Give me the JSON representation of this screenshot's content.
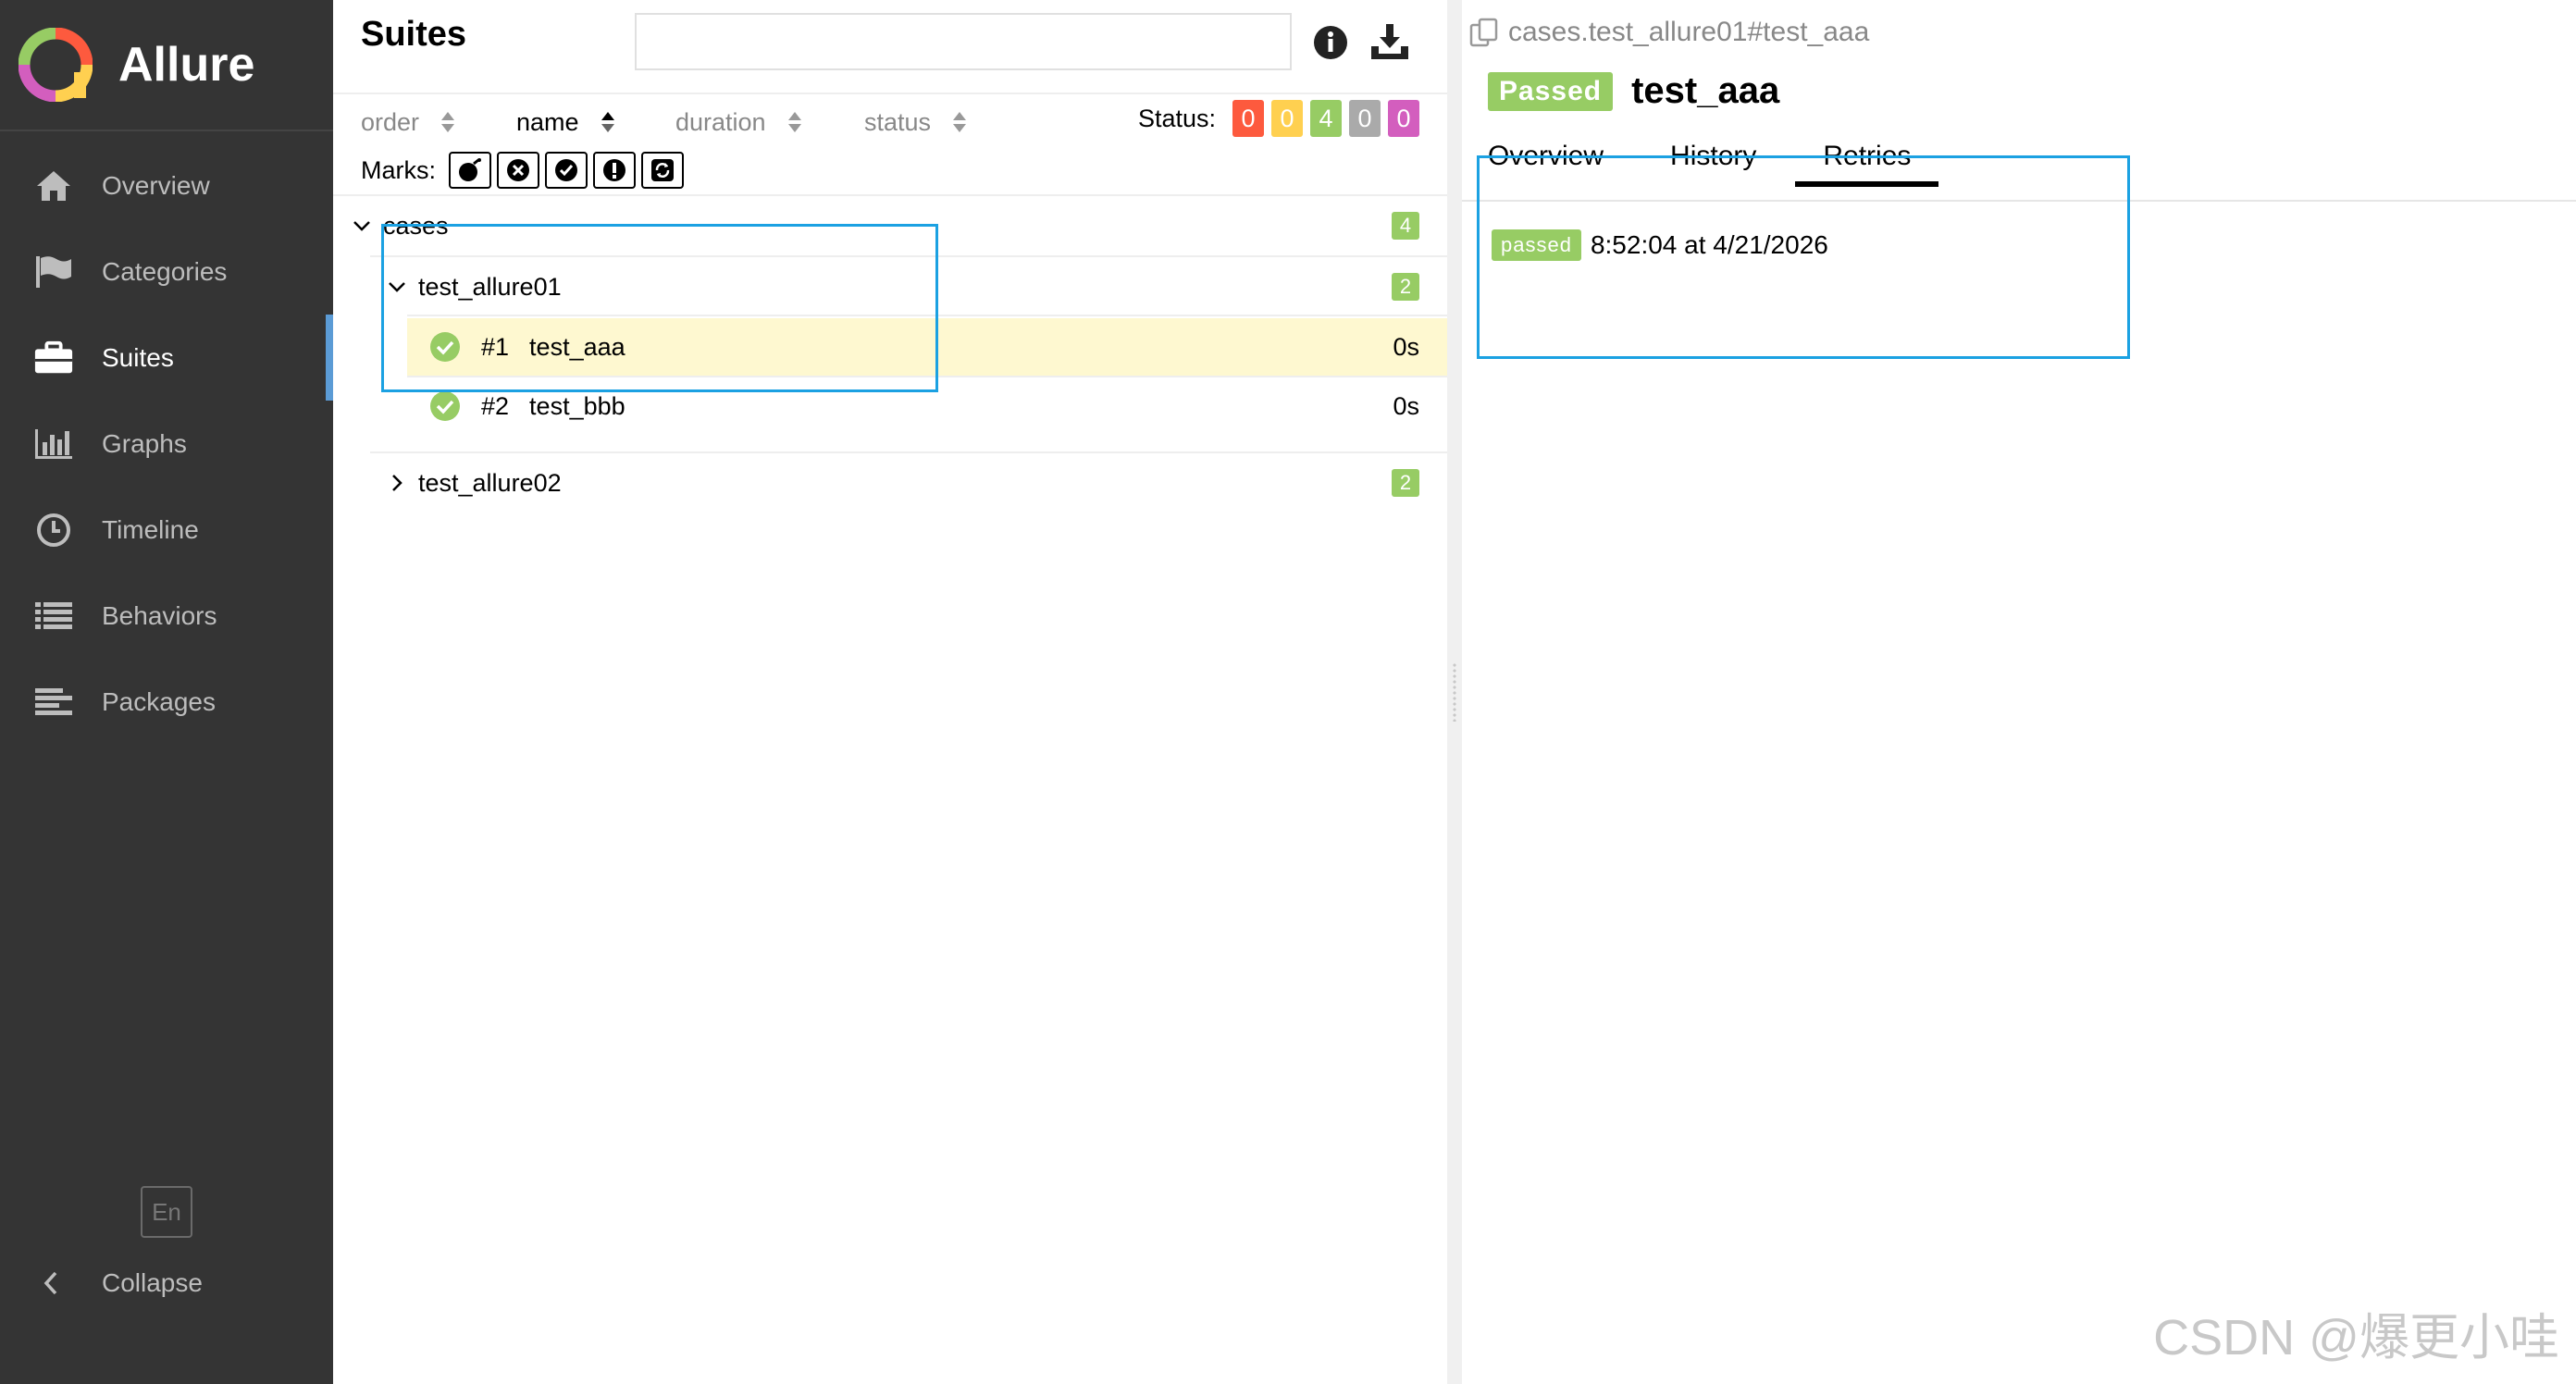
{
  "sidebar": {
    "brand": "Allure",
    "items": [
      {
        "label": "Overview",
        "icon": "home-icon"
      },
      {
        "label": "Categories",
        "icon": "flag-icon"
      },
      {
        "label": "Suites",
        "icon": "briefcase-icon"
      },
      {
        "label": "Graphs",
        "icon": "bar-chart-icon"
      },
      {
        "label": "Timeline",
        "icon": "clock-icon"
      },
      {
        "label": "Behaviors",
        "icon": "list-icon"
      },
      {
        "label": "Packages",
        "icon": "align-left-icon"
      }
    ],
    "active_item": "Suites",
    "language": "En",
    "collapse_label": "Collapse"
  },
  "suites": {
    "title": "Suites",
    "search_value": "",
    "sort": {
      "order": "order",
      "name": "name",
      "duration": "duration",
      "status": "status"
    },
    "status_label": "Status:",
    "status_counts": [
      {
        "value": "0",
        "color": "#fd5a3e"
      },
      {
        "value": "0",
        "color": "#ffd050"
      },
      {
        "value": "4",
        "color": "#97cc64"
      },
      {
        "value": "0",
        "color": "#aaaaaa"
      },
      {
        "value": "0",
        "color": "#d35ebe"
      }
    ],
    "marks_label": "Marks:",
    "tree": {
      "root": {
        "label": "cases",
        "count": "4"
      },
      "suite1": {
        "label": "test_allure01",
        "count": "2"
      },
      "cases": [
        {
          "num": "#1",
          "name": "test_aaa",
          "duration": "0s"
        },
        {
          "num": "#2",
          "name": "test_bbb",
          "duration": "0s"
        }
      ],
      "suite2": {
        "label": "test_allure02",
        "count": "2"
      }
    }
  },
  "detail": {
    "breadcrumb": "cases.test_allure01#test_aaa",
    "status": "Passed",
    "name": "test_aaa",
    "tabs": [
      "Overview",
      "History",
      "Retries"
    ],
    "active_tab": "Retries",
    "retry": {
      "status": "passed",
      "time": "8:52:04 at 4/21/2026"
    }
  },
  "watermark": "CSDN @爆更小哇",
  "colors": {
    "sidebar_bg": "#343434",
    "passed": "#97cc64",
    "selected_row": "#fef8d0",
    "highlight": "#1ba1e2",
    "active_indicator": "#5b9bd5"
  }
}
